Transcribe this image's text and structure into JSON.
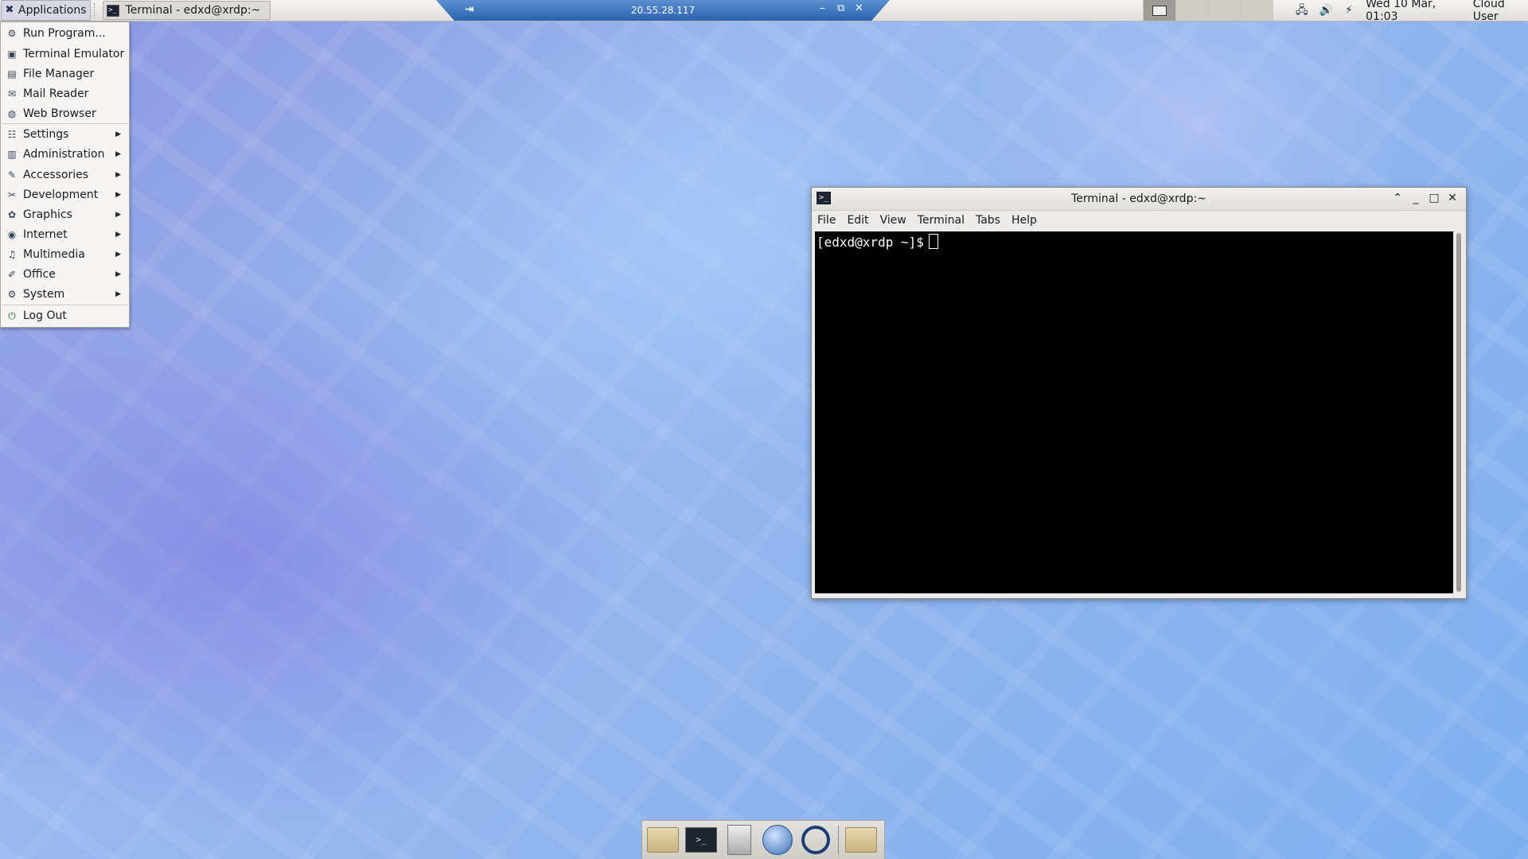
{
  "top_panel": {
    "applications_label": "Applications",
    "task_label": "Terminal - edxd@xrdp:~",
    "clock": "Wed 10 Mar, 01:03",
    "user": "Cloud User"
  },
  "rdp_bar": {
    "ip": "20.55.28.117",
    "pin_icon": "pin-icon",
    "minimize": "–",
    "restore": "⧉",
    "close": "✕"
  },
  "app_menu": {
    "items": [
      {
        "label": "Run Program...",
        "icon": "run-icon",
        "submenu": false
      },
      {
        "label": "Terminal Emulator",
        "icon": "terminal-icon",
        "submenu": false
      },
      {
        "label": "File Manager",
        "icon": "file-manager-icon",
        "submenu": false
      },
      {
        "label": "Mail Reader",
        "icon": "mail-icon",
        "submenu": false
      },
      {
        "label": "Web Browser",
        "icon": "web-browser-icon",
        "submenu": false
      },
      {
        "label": "Settings",
        "icon": "settings-icon",
        "submenu": true
      },
      {
        "label": "Administration",
        "icon": "administration-icon",
        "submenu": true
      },
      {
        "label": "Accessories",
        "icon": "accessories-icon",
        "submenu": true
      },
      {
        "label": "Development",
        "icon": "development-icon",
        "submenu": true
      },
      {
        "label": "Graphics",
        "icon": "graphics-icon",
        "submenu": true
      },
      {
        "label": "Internet",
        "icon": "internet-icon",
        "submenu": true
      },
      {
        "label": "Multimedia",
        "icon": "multimedia-icon",
        "submenu": true
      },
      {
        "label": "Office",
        "icon": "office-icon",
        "submenu": true
      },
      {
        "label": "System",
        "icon": "system-icon",
        "submenu": true
      },
      {
        "label": "Log Out",
        "icon": "log-out-icon",
        "submenu": false
      }
    ]
  },
  "terminal": {
    "title": "Terminal - edxd@xrdp:~",
    "menu": [
      "File",
      "Edit",
      "View",
      "Terminal",
      "Tabs",
      "Help"
    ],
    "prompt": "[edxd@xrdp ~]$"
  },
  "dock": {
    "items": [
      "home-folder-icon",
      "terminal-icon",
      "file-cabinet-icon",
      "web-browser-icon",
      "search-icon",
      "folder-icon"
    ]
  }
}
